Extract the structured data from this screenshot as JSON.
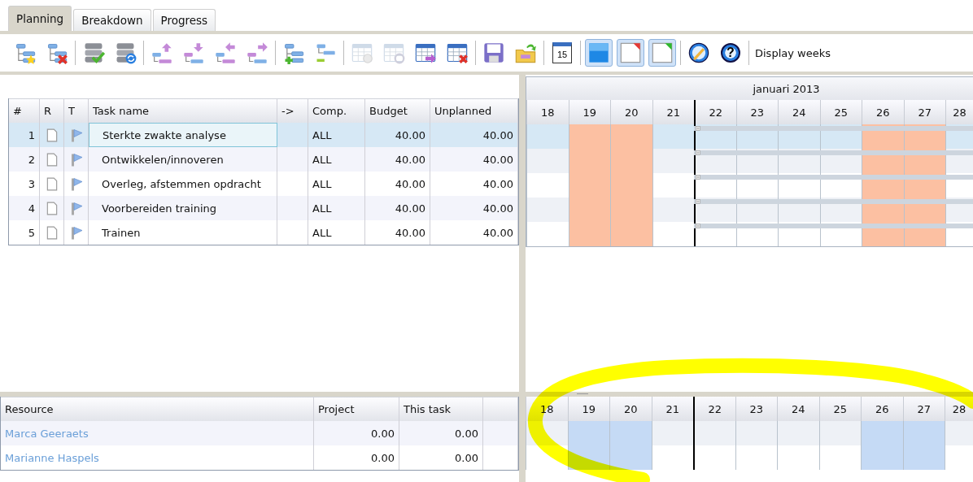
{
  "tabs": [
    {
      "label": "Planning",
      "selected": true
    },
    {
      "label": "Breakdown",
      "selected": false
    },
    {
      "label": "Progress",
      "selected": false
    }
  ],
  "toolbar": [
    {
      "kind": "button",
      "disabled": false
    },
    {
      "kind": "button",
      "disabled": false
    },
    {
      "kind": "separator"
    },
    {
      "kind": "button",
      "disabled": false
    },
    {
      "kind": "button",
      "disabled": false
    },
    {
      "kind": "separator"
    },
    {
      "kind": "button",
      "disabled": false
    },
    {
      "kind": "button",
      "disabled": false
    },
    {
      "kind": "button",
      "disabled": false
    },
    {
      "kind": "button",
      "disabled": false
    },
    {
      "kind": "separator"
    },
    {
      "kind": "button",
      "disabled": false
    },
    {
      "kind": "button",
      "disabled": false
    },
    {
      "kind": "separator"
    },
    {
      "kind": "button",
      "disabled": true
    },
    {
      "kind": "button",
      "disabled": true
    },
    {
      "kind": "button",
      "disabled": false
    },
    {
      "kind": "button",
      "disabled": false
    },
    {
      "kind": "separator"
    },
    {
      "kind": "button",
      "disabled": false
    },
    {
      "kind": "button",
      "disabled": false
    },
    {
      "kind": "separator"
    },
    {
      "kind": "button",
      "disabled": false,
      "text": "15"
    },
    {
      "kind": "separator"
    },
    {
      "kind": "toggle",
      "disabled": false,
      "pressed": true
    },
    {
      "kind": "toggle",
      "disabled": false,
      "pressed": true
    },
    {
      "kind": "toggle",
      "disabled": false,
      "pressed": true
    },
    {
      "kind": "separator"
    },
    {
      "kind": "button",
      "disabled": false
    },
    {
      "kind": "button",
      "disabled": false,
      "text": "?"
    },
    {
      "kind": "separator"
    },
    {
      "kind": "label",
      "text": "Display weeks"
    }
  ],
  "tasks": {
    "columns": [
      "#",
      "R",
      "T",
      "Task name",
      "->",
      "Comp.",
      "Budget",
      "Unplanned"
    ],
    "rows": [
      {
        "number": "1",
        "name": "Sterkte zwakte analyse",
        "comp": "ALL",
        "budget": "40.00",
        "unplanned": "40.00",
        "selected": true
      },
      {
        "number": "2",
        "name": "Ontwikkelen/innoveren",
        "comp": "ALL",
        "budget": "40.00",
        "unplanned": "40.00",
        "selected": false
      },
      {
        "number": "3",
        "name": "Overleg, afstemmen opdracht",
        "comp": "ALL",
        "budget": "40.00",
        "unplanned": "40.00",
        "selected": false
      },
      {
        "number": "4",
        "name": "Voorbereiden training",
        "comp": "ALL",
        "budget": "40.00",
        "unplanned": "40.00",
        "selected": false
      },
      {
        "number": "5",
        "name": "Trainen",
        "comp": "ALL",
        "budget": "40.00",
        "unplanned": "40.00",
        "selected": false
      }
    ]
  },
  "gantt": {
    "month": "januari 2013",
    "days": [
      {
        "label": "18",
        "weekend": false,
        "today": false
      },
      {
        "label": "19",
        "weekend": true,
        "today": false
      },
      {
        "label": "20",
        "weekend": true,
        "today": false
      },
      {
        "label": "21",
        "weekend": false,
        "today": false
      },
      {
        "label": "22",
        "weekend": false,
        "today": true
      },
      {
        "label": "23",
        "weekend": false,
        "today": false
      },
      {
        "label": "24",
        "weekend": false,
        "today": false
      },
      {
        "label": "25",
        "weekend": false,
        "today": false
      },
      {
        "label": "26",
        "weekend": true,
        "today": false
      },
      {
        "label": "27",
        "weekend": true,
        "today": false
      },
      {
        "label": "28",
        "weekend": false,
        "today": false
      }
    ]
  },
  "resources": {
    "columns": [
      "Resource",
      "Project",
      "This task"
    ],
    "rows": [
      {
        "name": "Marca Geeraets",
        "project": "0.00",
        "this_task": "0.00"
      },
      {
        "name": "Marianne Haspels",
        "project": "0.00",
        "this_task": "0.00"
      }
    ]
  },
  "resource_gantt": {
    "days": [
      {
        "label": "18",
        "weekend": false,
        "today": false
      },
      {
        "label": "19",
        "weekend": true,
        "today": false
      },
      {
        "label": "20",
        "weekend": true,
        "today": false
      },
      {
        "label": "21",
        "weekend": false,
        "today": false
      },
      {
        "label": "22",
        "weekend": false,
        "today": true
      },
      {
        "label": "23",
        "weekend": false,
        "today": false
      },
      {
        "label": "24",
        "weekend": false,
        "today": false
      },
      {
        "label": "25",
        "weekend": false,
        "today": false
      },
      {
        "label": "26",
        "weekend": true,
        "today": false
      },
      {
        "label": "27",
        "weekend": true,
        "today": false
      },
      {
        "label": "28",
        "weekend": false,
        "today": false
      }
    ]
  },
  "highlight": {
    "kind": "ellipse"
  }
}
